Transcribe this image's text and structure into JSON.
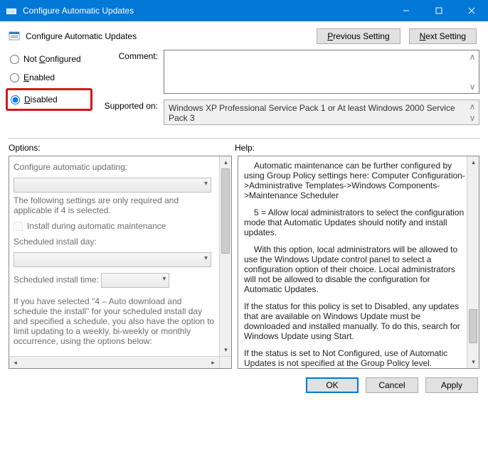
{
  "titlebar": {
    "title": "Configure Automatic Updates"
  },
  "header": {
    "title": "Configure Automatic Updates",
    "prev": "Previous Setting",
    "next": "Next Setting"
  },
  "radios": {
    "not_configured_pre": "Not ",
    "not_configured_u": "C",
    "not_configured_post": "onfigured",
    "enabled_u": "E",
    "enabled_post": "nabled",
    "disabled_u": "D",
    "disabled_post": "isabled"
  },
  "fields": {
    "comment_label": "Comment:",
    "supported_label": "Supported on:",
    "supported_value": "Windows XP Professional Service Pack 1 or At least Windows 2000 Service Pack 3"
  },
  "labels": {
    "options": "Options:",
    "help": "Help:"
  },
  "options": {
    "configure_label": "Configure automatic updating:",
    "required_text": "The following settings are only required and applicable if 4 is selected.",
    "install_checkbox": "Install during automatic maintenance",
    "day_label": "Scheduled install day:",
    "time_label": "Scheduled install time:",
    "para": "If you have selected \"4 – Auto download and schedule the install\" for your scheduled install day and specified a schedule, you also have the option to limit updating to a weekly, bi-weekly or monthly occurrence, using the options below:"
  },
  "help": {
    "p1": "Automatic maintenance can be further configured by using Group Policy settings here: Computer Configuration->Administrative Templates->Windows Components->Maintenance Scheduler",
    "p2": "5 = Allow local administrators to select the configuration mode that Automatic Updates should notify and install updates.",
    "p3": "With this option, local administrators will be allowed to use the Windows Update control panel to select a configuration option of their choice. Local administrators will not be allowed to disable the configuration for Automatic Updates.",
    "p4": "If the status for this policy is set to Disabled, any updates that are available on Windows Update must be downloaded and installed manually. To do this, search for Windows Update using Start.",
    "p5": "If the status is set to Not Configured, use of Automatic Updates is not specified at the Group Policy level. However, an administrator can still configure Automatic Updates through Control Panel."
  },
  "footer": {
    "ok": "OK",
    "cancel": "Cancel",
    "apply": "Apply"
  }
}
